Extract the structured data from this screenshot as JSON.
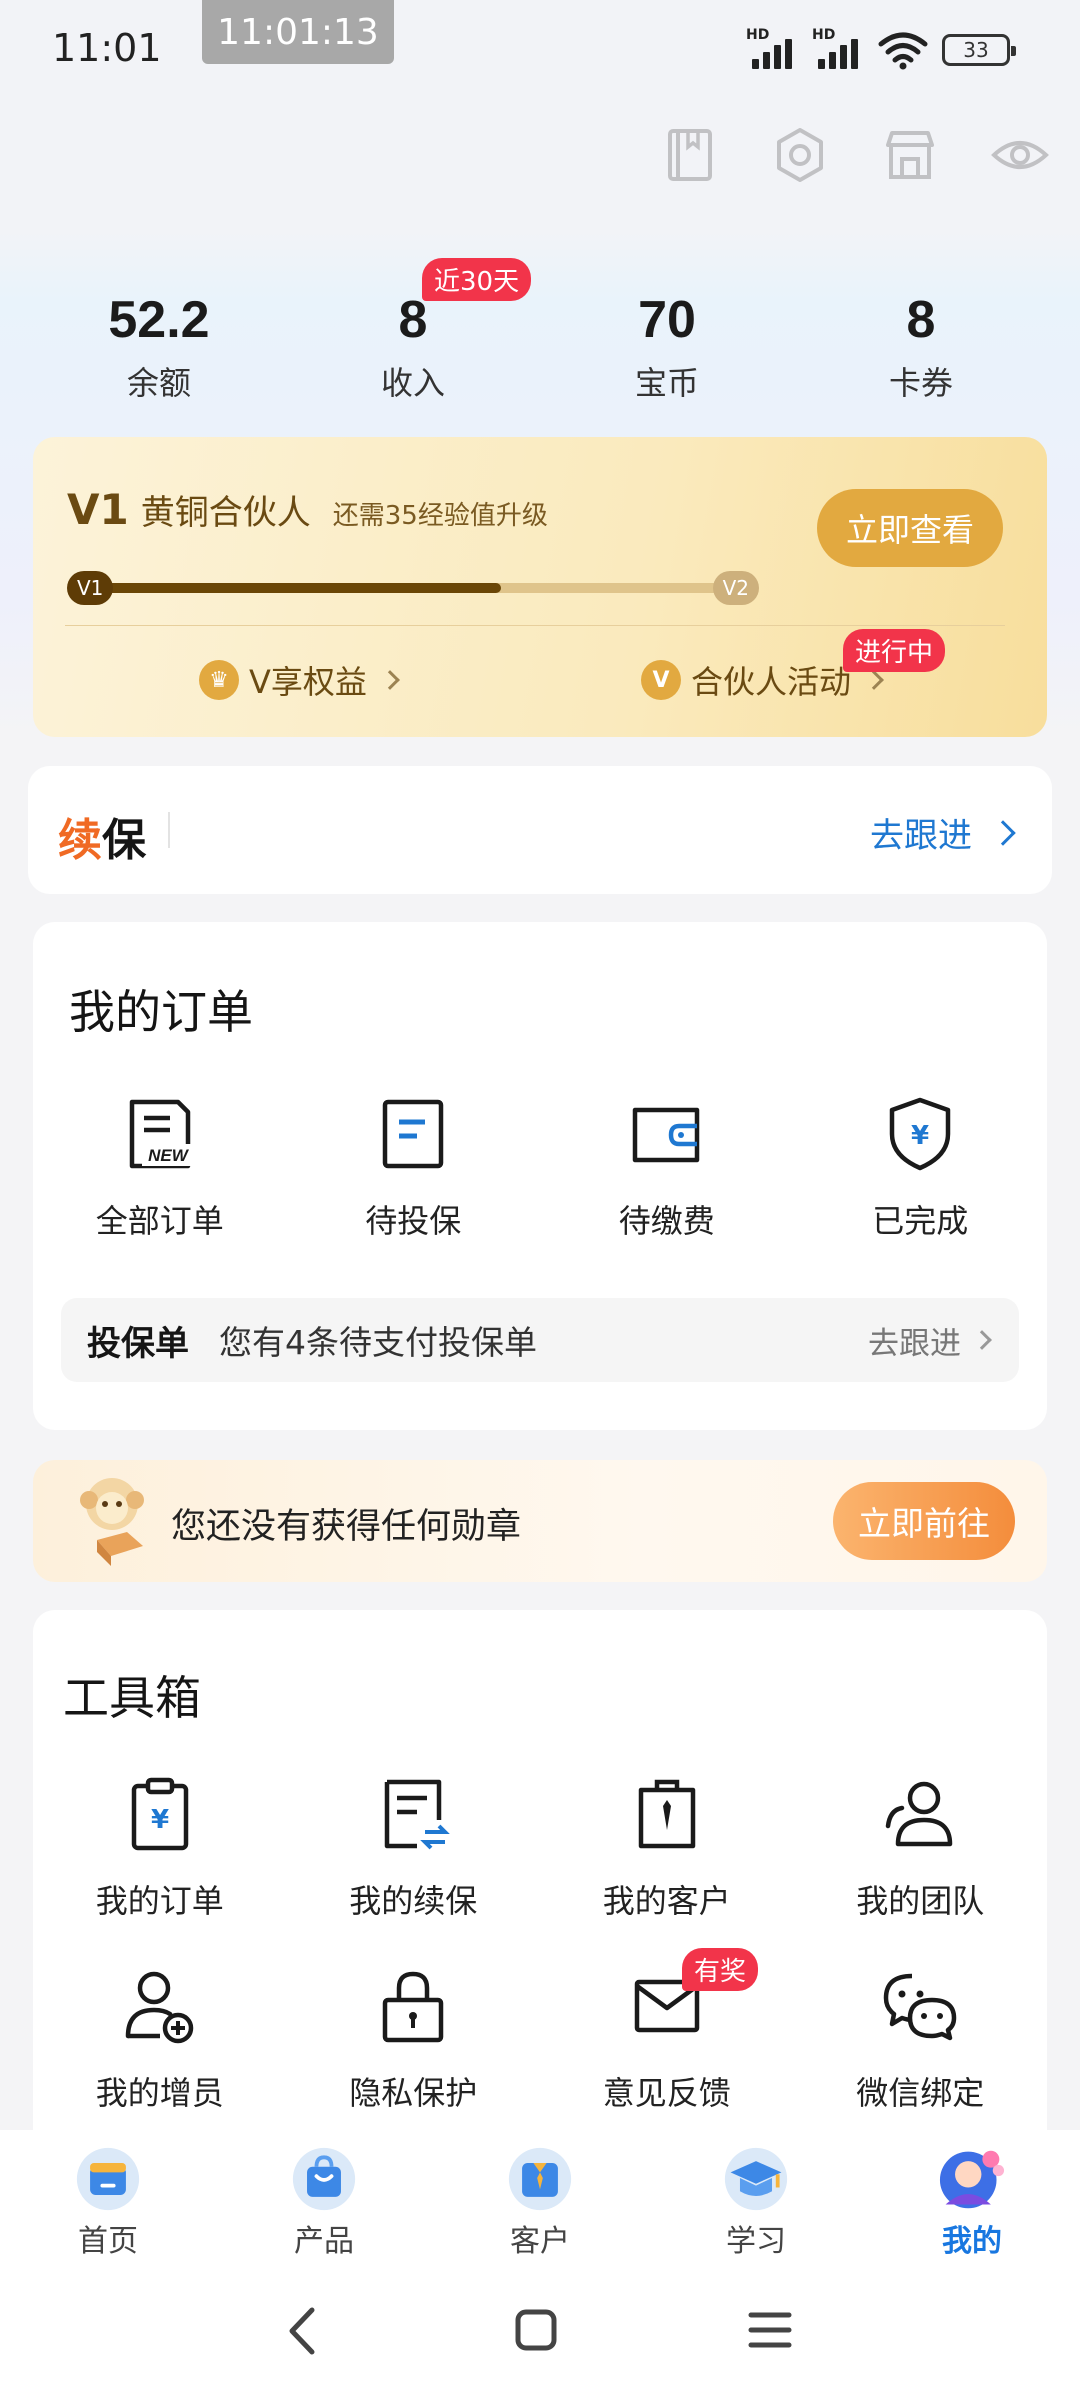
{
  "status_bar": {
    "time": "11:01",
    "recording_timer": "11:01:13",
    "battery": "33",
    "hd1": "HD",
    "hd2": "HD"
  },
  "header_icons": [
    "book-icon",
    "gear-icon",
    "store-icon",
    "eye-icon"
  ],
  "stats": [
    {
      "value": "52.2",
      "label": "余额"
    },
    {
      "value": "8",
      "label": "收入",
      "badge": "近30天"
    },
    {
      "value": "70",
      "label": "宝币"
    },
    {
      "value": "8",
      "label": "卡券"
    }
  ],
  "level": {
    "current": "V1",
    "name": "黄铜合伙人",
    "need": "还需35经验值升级",
    "button": "立即查看",
    "cur_badge": "V1",
    "next_badge": "V2",
    "progress": 0.63,
    "benefit_label": "V享权益",
    "benefit_icon_text": "♛",
    "activity_label": "合伙人活动",
    "activity_icon_text": "V",
    "activity_badge": "进行中"
  },
  "renewal": {
    "title_accent": "续",
    "title_rest": "保",
    "link": "去跟进"
  },
  "orders": {
    "title": "我的订单",
    "items": [
      {
        "label": "全部订单",
        "icon": "new-order-icon"
      },
      {
        "label": "待投保",
        "icon": "document-icon"
      },
      {
        "label": "待缴费",
        "icon": "wallet-icon"
      },
      {
        "label": "已完成",
        "icon": "shield-yuan-icon"
      }
    ],
    "policy_bar": {
      "title": "投保单",
      "text": "您有4条待支付投保单",
      "link": "去跟进"
    }
  },
  "medal": {
    "text": "您还没有获得任何勋章",
    "button": "立即前往"
  },
  "toolbox": {
    "title": "工具箱",
    "items": [
      {
        "label": "我的订单",
        "icon": "clipboard-yuan-icon"
      },
      {
        "label": "我的续保",
        "icon": "renewal-doc-icon"
      },
      {
        "label": "我的客户",
        "icon": "client-bag-icon"
      },
      {
        "label": "我的团队",
        "icon": "team-icon"
      },
      {
        "label": "我的增员",
        "icon": "add-user-icon"
      },
      {
        "label": "隐私保护",
        "icon": "lock-icon"
      },
      {
        "label": "意见反馈",
        "icon": "mail-icon",
        "badge": "有奖"
      },
      {
        "label": "微信绑定",
        "icon": "wechat-icon"
      }
    ]
  },
  "bottom_nav": [
    {
      "label": "首页",
      "icon": "home-icon"
    },
    {
      "label": "产品",
      "icon": "bag-icon"
    },
    {
      "label": "客户",
      "icon": "customer-icon"
    },
    {
      "label": "学习",
      "icon": "graduation-cap-icon"
    },
    {
      "label": "我的",
      "icon": "mine-avatar-icon",
      "active": true
    }
  ],
  "colors": {
    "accent": "#1877e0",
    "badge_red": "#f2344a",
    "gold": "#e2a940",
    "orange": "#f48d3c"
  }
}
